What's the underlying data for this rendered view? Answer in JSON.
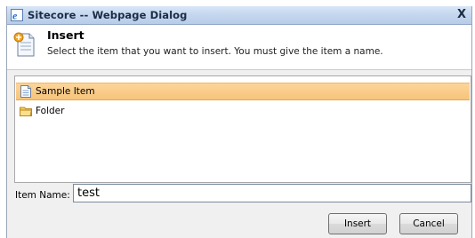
{
  "window": {
    "title": "Sitecore -- Webpage Dialog",
    "close_glyph": "X",
    "title_icon": "ie-page-icon"
  },
  "header": {
    "title": "Insert",
    "description": "Select the item that you want to insert. You must give the item a name.",
    "icon": "insert-document-icon"
  },
  "items": [
    {
      "label": "Sample Item",
      "icon": "document-icon",
      "selected": true
    },
    {
      "label": "Folder",
      "icon": "folder-icon",
      "selected": false
    }
  ],
  "form": {
    "item_name_label": "Item Name:",
    "item_name_value": "test"
  },
  "buttons": {
    "insert_label": "Insert",
    "cancel_label": "Cancel"
  },
  "colors": {
    "selection": "#f7c47a",
    "titlebar": "#c6d8ef"
  }
}
